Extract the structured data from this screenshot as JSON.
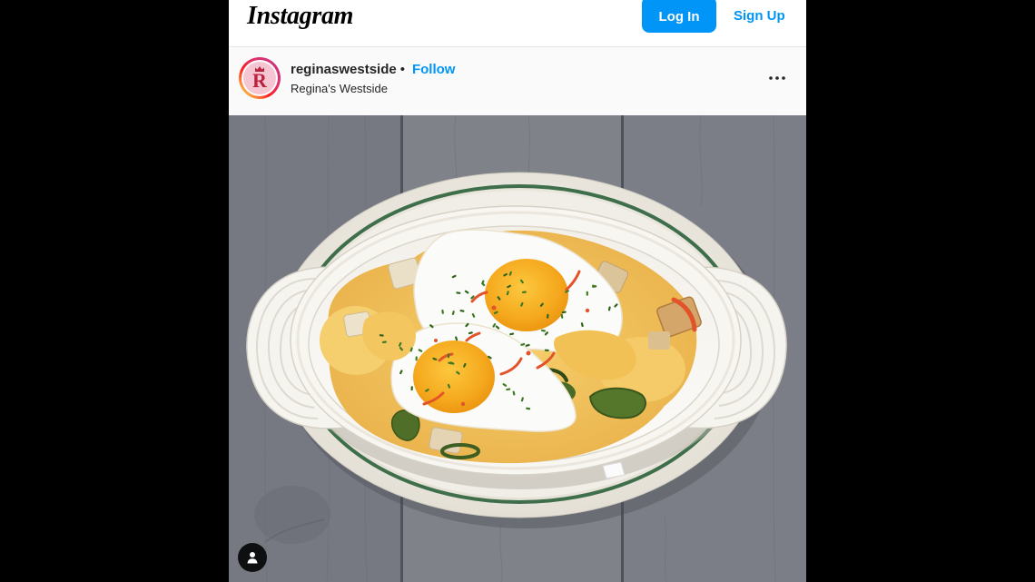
{
  "header": {
    "logo_text": "Instagram",
    "login_label": "Log In",
    "signup_label": "Sign Up"
  },
  "post": {
    "avatar_letter": "R",
    "username": "reginaswestside",
    "separator": "•",
    "follow_label": "Follow",
    "location": "Regina's Westside",
    "more_icon": "more-horizontal-icon"
  },
  "photo": {
    "tag_icon": "user-tag-icon"
  },
  "colors": {
    "accent": "#0095f6",
    "page_background": "#000000",
    "embed_background": "#ffffff",
    "text_primary": "#262626"
  }
}
